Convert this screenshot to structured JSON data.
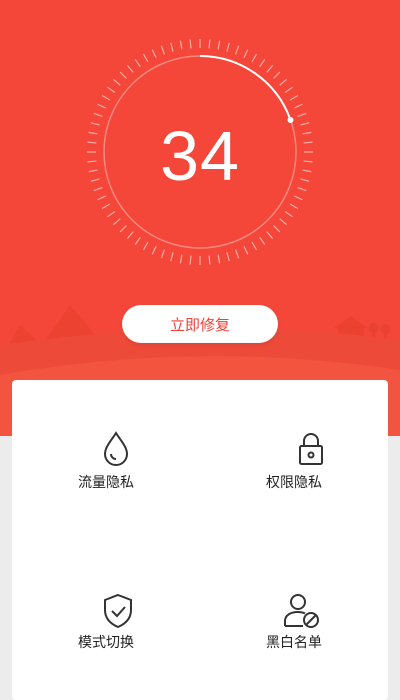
{
  "score": {
    "value": "34"
  },
  "fix_button": {
    "label": "立即修复"
  },
  "features": [
    {
      "label": "流量隐私",
      "icon": "droplet-icon"
    },
    {
      "label": "权限隐私",
      "icon": "lock-icon"
    },
    {
      "label": "模式切换",
      "icon": "shield-check-icon"
    },
    {
      "label": "黑白名单",
      "icon": "user-block-icon"
    }
  ],
  "colors": {
    "primary": "#f4473a",
    "button_text": "#ef4136",
    "page_background": "#ececec"
  }
}
